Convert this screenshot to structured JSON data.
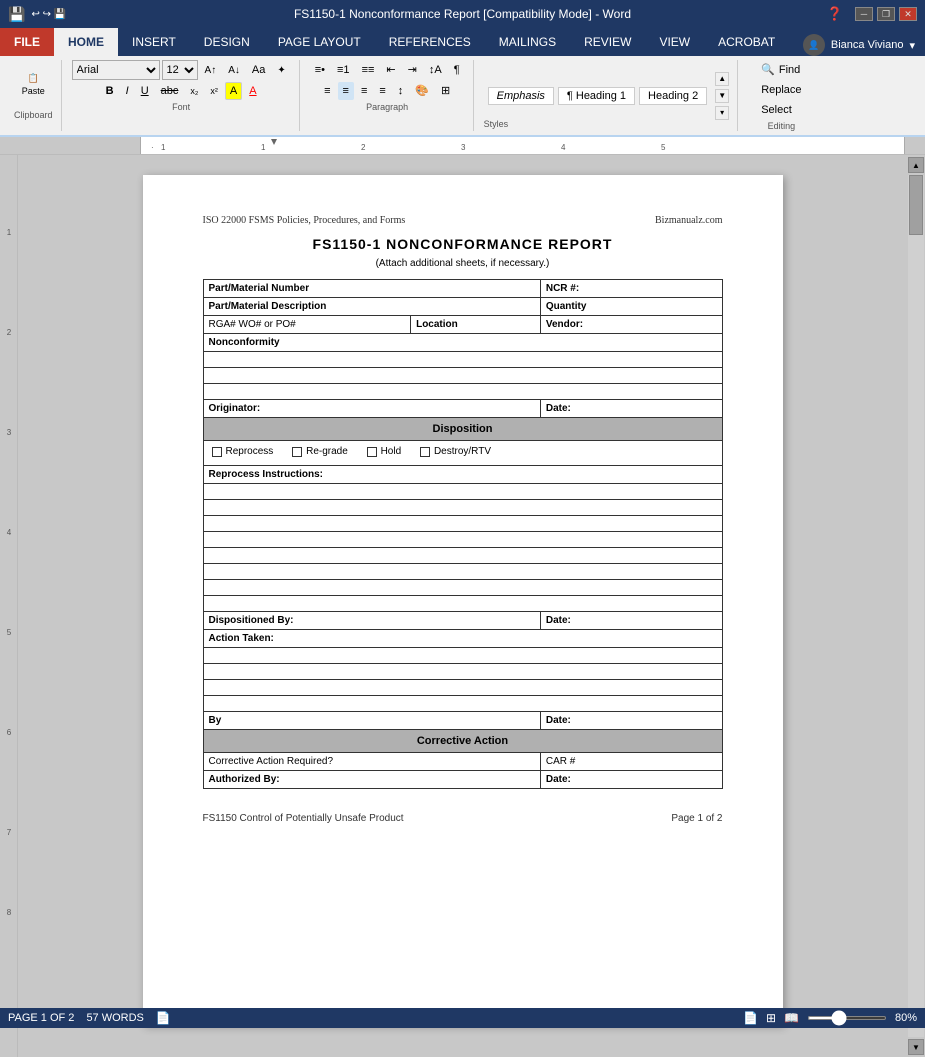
{
  "titlebar": {
    "title": "FS1150-1 Nonconformance Report [Compatibility Mode] - Word",
    "app": "Word",
    "controls": [
      "minimize",
      "restore",
      "close"
    ]
  },
  "tabs": {
    "items": [
      "FILE",
      "HOME",
      "INSERT",
      "DESIGN",
      "PAGE LAYOUT",
      "REFERENCES",
      "MAILINGS",
      "REVIEW",
      "VIEW",
      "ACROBAT"
    ],
    "active": "HOME"
  },
  "ribbon": {
    "font_face": "Arial",
    "font_size": "12",
    "paste_label": "Paste",
    "clipboard_label": "Clipboard",
    "font_label": "Font",
    "paragraph_label": "Paragraph",
    "styles_label": "Styles",
    "editing_label": "Editing",
    "find_label": "Find",
    "replace_label": "Replace",
    "select_label": "Select",
    "emphasis_label": "Emphasis",
    "heading1_label": "¶ Heading 1",
    "heading2_label": "Heading 2",
    "user": "Bianca Viviano"
  },
  "document": {
    "header_left": "ISO 22000 FSMS Policies, Procedures, and Forms",
    "header_right": "Bizmanualz.com",
    "title": "FS1150-1   NONCONFORMANCE REPORT",
    "subtitle": "(Attach additional sheets, if necessary.)",
    "sections": {
      "part_material_number_label": "Part/Material Number",
      "ncr_label": "NCR #:",
      "part_material_desc_label": "Part/Material Description",
      "quantity_label": "Quantity",
      "rga_label": "RGA# WO# or PO#",
      "location_label": "Location",
      "vendor_label": "Vendor:",
      "nonconformity_label": "Nonconformity",
      "originator_label": "Originator:",
      "date_label": "Date:",
      "disposition_label": "Disposition",
      "reprocess_label": "Reprocess",
      "regrade_label": "Re-grade",
      "hold_label": "Hold",
      "destroy_rtv_label": "Destroy/RTV",
      "reprocess_instructions_label": "Reprocess Instructions:",
      "dispositioned_by_label": "Dispositioned By:",
      "action_taken_label": "Action Taken:",
      "by_label": "By",
      "corrective_action_label": "Corrective Action",
      "corrective_action_required_label": "Corrective Action Required?",
      "car_label": "CAR #",
      "authorized_by_label": "Authorized By:"
    },
    "footer_left": "FS1150 Control of Potentially Unsafe Product",
    "footer_right": "Page 1 of 2"
  },
  "statusbar": {
    "page_info": "PAGE 1 OF 2",
    "word_count": "57 WORDS",
    "zoom_level": "80%"
  }
}
